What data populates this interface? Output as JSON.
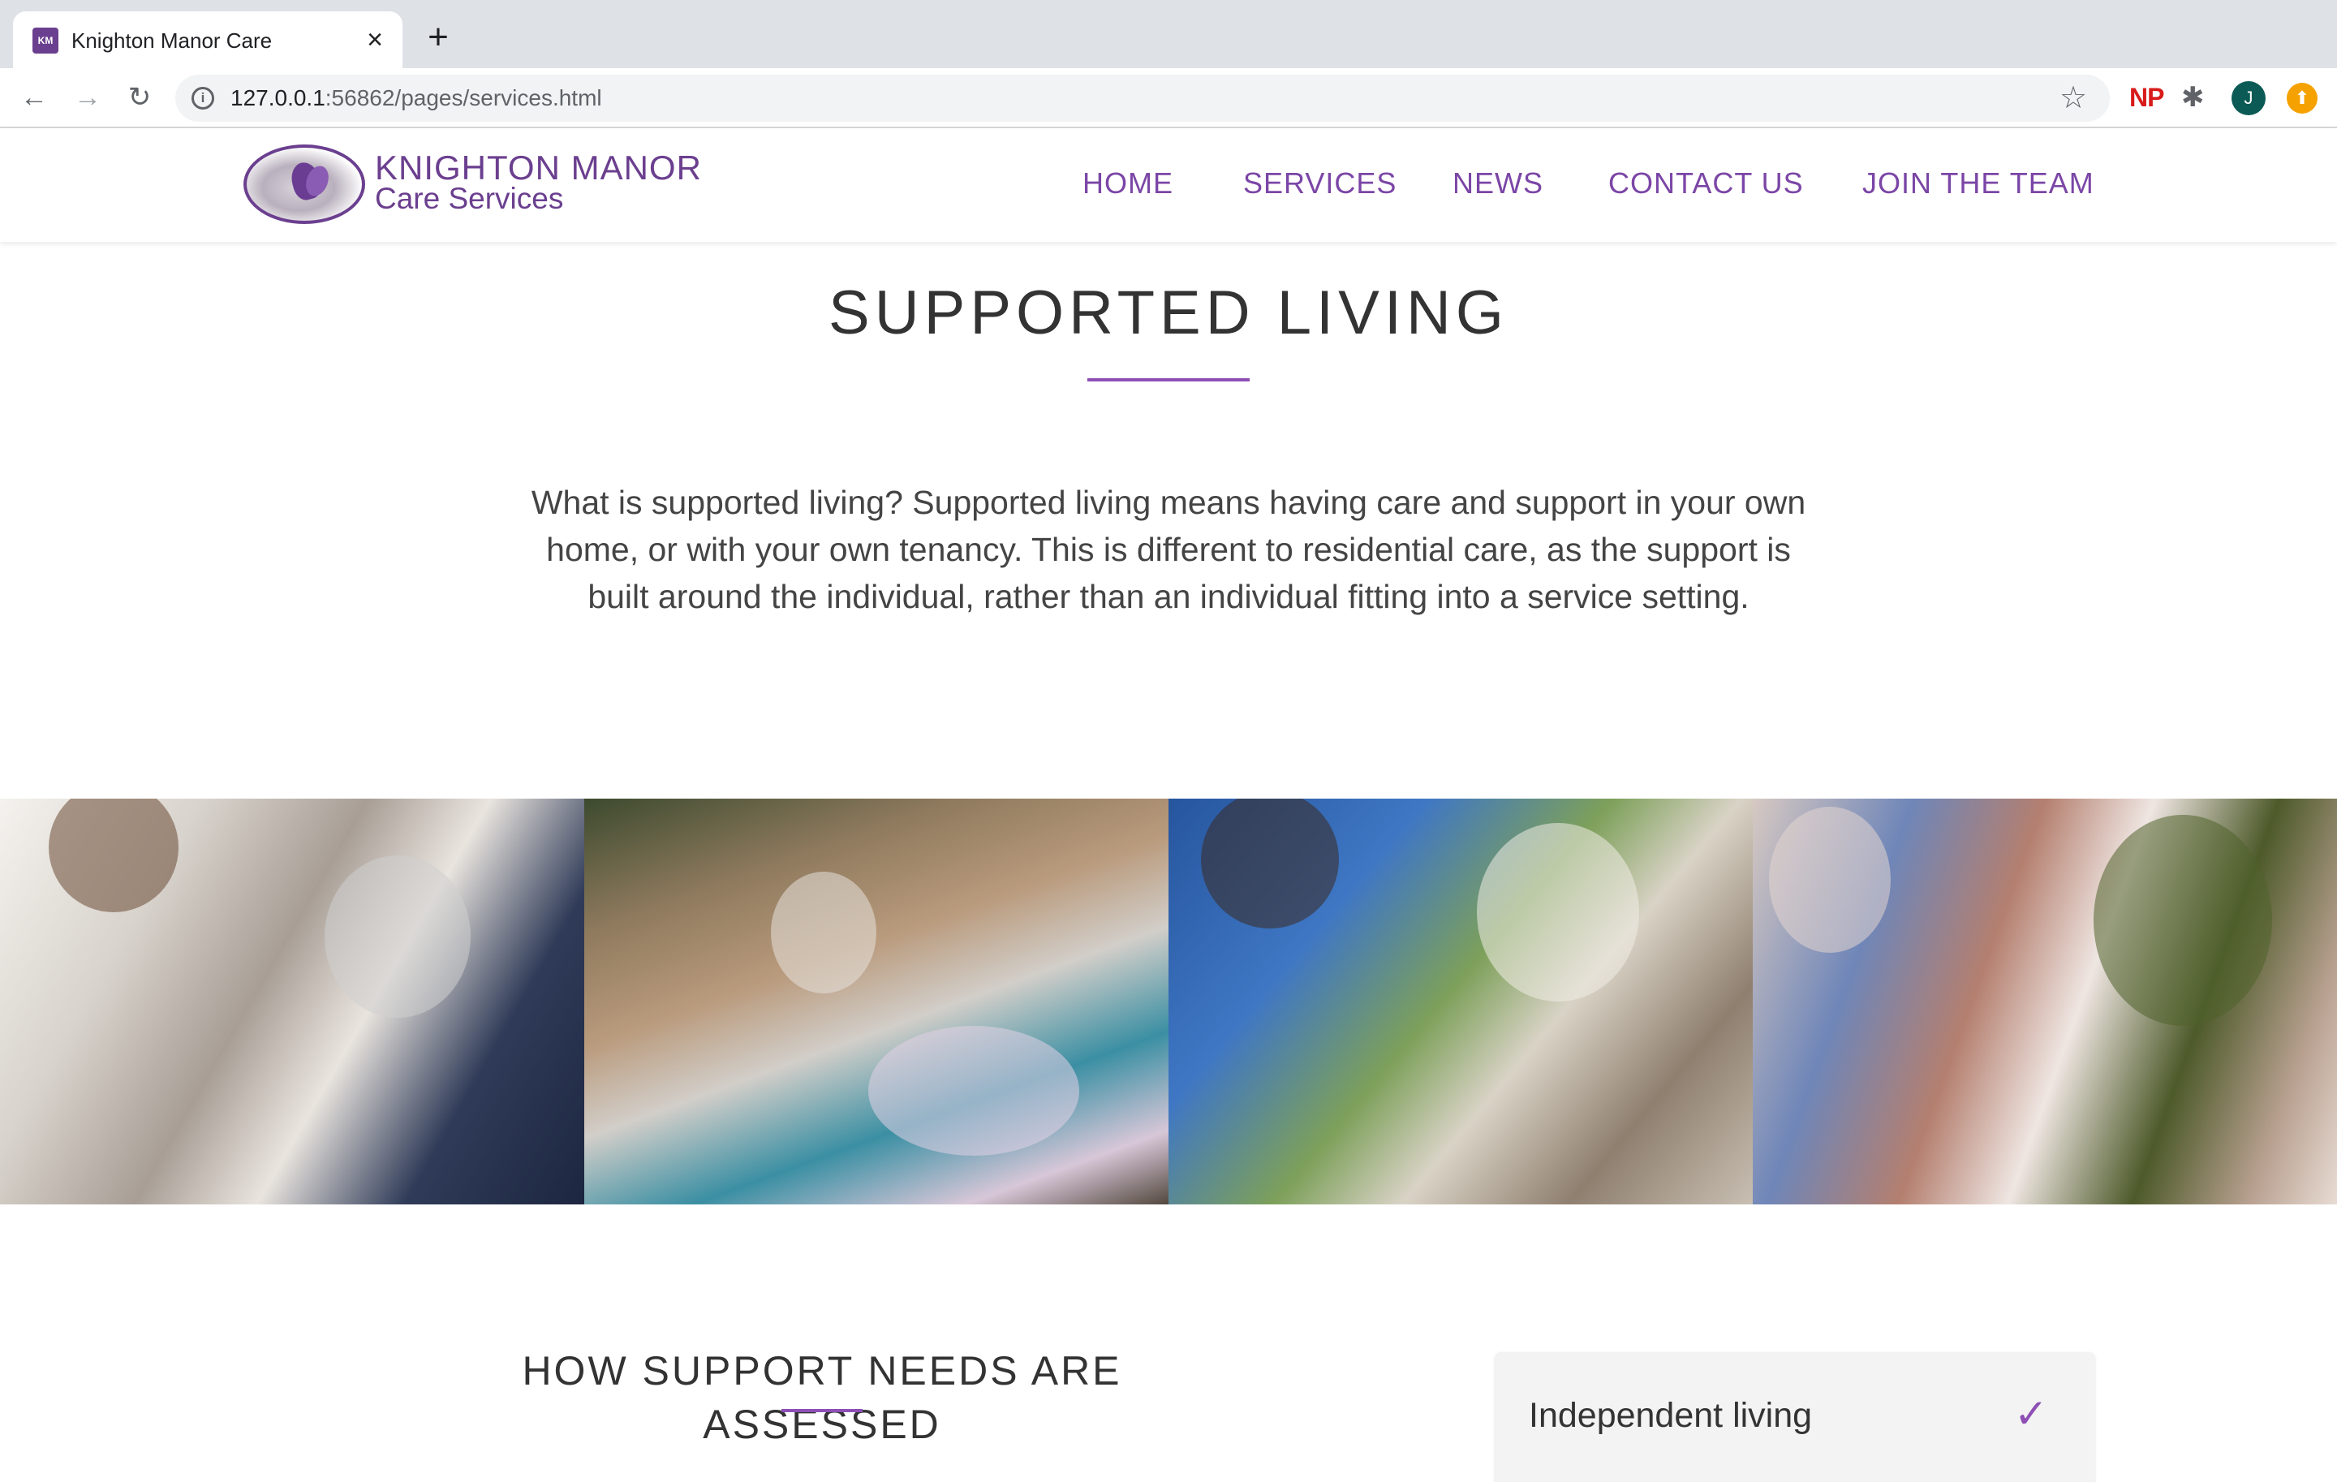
{
  "browser": {
    "tab_title": "Knighton Manor Care",
    "favicon_text": "KM",
    "url_host": "127.0.0.1",
    "url_rest": ":56862/pages/services.html",
    "ext_np": "NP",
    "profile_initial": "J"
  },
  "site": {
    "logo_line1": "KNIGHTON MANOR",
    "logo_line2": "Care Services",
    "nav": [
      "HOME",
      "SERVICES",
      "NEWS",
      "CONTACT US",
      "JOIN THE TEAM"
    ],
    "accent_color": "#8e4fb5"
  },
  "main": {
    "title": "SUPPORTED LIVING",
    "intro": "What is supported living? Supported living means having care and support in your own home, or with your own tenancy. This is different to residential care, as the support is built around the individual, rather than an individual fitting into a service setting."
  },
  "assessment": {
    "heading": "HOW SUPPORT NEEDS ARE ASSESSED",
    "accordion_item": "Independent living",
    "check_icon": "✓"
  }
}
